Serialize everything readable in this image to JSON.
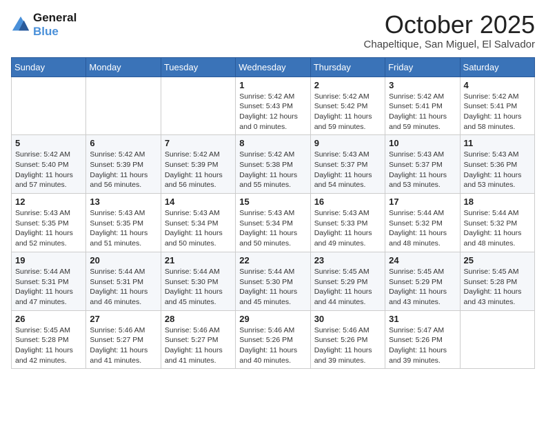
{
  "logo": {
    "line1": "General",
    "line2": "Blue"
  },
  "title": "October 2025",
  "location": "Chapeltique, San Miguel, El Salvador",
  "days_of_week": [
    "Sunday",
    "Monday",
    "Tuesday",
    "Wednesday",
    "Thursday",
    "Friday",
    "Saturday"
  ],
  "weeks": [
    [
      {
        "day": "",
        "sunrise": "",
        "sunset": "",
        "daylight": ""
      },
      {
        "day": "",
        "sunrise": "",
        "sunset": "",
        "daylight": ""
      },
      {
        "day": "",
        "sunrise": "",
        "sunset": "",
        "daylight": ""
      },
      {
        "day": "1",
        "sunrise": "Sunrise: 5:42 AM",
        "sunset": "Sunset: 5:43 PM",
        "daylight": "Daylight: 12 hours and 0 minutes."
      },
      {
        "day": "2",
        "sunrise": "Sunrise: 5:42 AM",
        "sunset": "Sunset: 5:42 PM",
        "daylight": "Daylight: 11 hours and 59 minutes."
      },
      {
        "day": "3",
        "sunrise": "Sunrise: 5:42 AM",
        "sunset": "Sunset: 5:41 PM",
        "daylight": "Daylight: 11 hours and 59 minutes."
      },
      {
        "day": "4",
        "sunrise": "Sunrise: 5:42 AM",
        "sunset": "Sunset: 5:41 PM",
        "daylight": "Daylight: 11 hours and 58 minutes."
      }
    ],
    [
      {
        "day": "5",
        "sunrise": "Sunrise: 5:42 AM",
        "sunset": "Sunset: 5:40 PM",
        "daylight": "Daylight: 11 hours and 57 minutes."
      },
      {
        "day": "6",
        "sunrise": "Sunrise: 5:42 AM",
        "sunset": "Sunset: 5:39 PM",
        "daylight": "Daylight: 11 hours and 56 minutes."
      },
      {
        "day": "7",
        "sunrise": "Sunrise: 5:42 AM",
        "sunset": "Sunset: 5:39 PM",
        "daylight": "Daylight: 11 hours and 56 minutes."
      },
      {
        "day": "8",
        "sunrise": "Sunrise: 5:42 AM",
        "sunset": "Sunset: 5:38 PM",
        "daylight": "Daylight: 11 hours and 55 minutes."
      },
      {
        "day": "9",
        "sunrise": "Sunrise: 5:43 AM",
        "sunset": "Sunset: 5:37 PM",
        "daylight": "Daylight: 11 hours and 54 minutes."
      },
      {
        "day": "10",
        "sunrise": "Sunrise: 5:43 AM",
        "sunset": "Sunset: 5:37 PM",
        "daylight": "Daylight: 11 hours and 53 minutes."
      },
      {
        "day": "11",
        "sunrise": "Sunrise: 5:43 AM",
        "sunset": "Sunset: 5:36 PM",
        "daylight": "Daylight: 11 hours and 53 minutes."
      }
    ],
    [
      {
        "day": "12",
        "sunrise": "Sunrise: 5:43 AM",
        "sunset": "Sunset: 5:35 PM",
        "daylight": "Daylight: 11 hours and 52 minutes."
      },
      {
        "day": "13",
        "sunrise": "Sunrise: 5:43 AM",
        "sunset": "Sunset: 5:35 PM",
        "daylight": "Daylight: 11 hours and 51 minutes."
      },
      {
        "day": "14",
        "sunrise": "Sunrise: 5:43 AM",
        "sunset": "Sunset: 5:34 PM",
        "daylight": "Daylight: 11 hours and 50 minutes."
      },
      {
        "day": "15",
        "sunrise": "Sunrise: 5:43 AM",
        "sunset": "Sunset: 5:34 PM",
        "daylight": "Daylight: 11 hours and 50 minutes."
      },
      {
        "day": "16",
        "sunrise": "Sunrise: 5:43 AM",
        "sunset": "Sunset: 5:33 PM",
        "daylight": "Daylight: 11 hours and 49 minutes."
      },
      {
        "day": "17",
        "sunrise": "Sunrise: 5:44 AM",
        "sunset": "Sunset: 5:32 PM",
        "daylight": "Daylight: 11 hours and 48 minutes."
      },
      {
        "day": "18",
        "sunrise": "Sunrise: 5:44 AM",
        "sunset": "Sunset: 5:32 PM",
        "daylight": "Daylight: 11 hours and 48 minutes."
      }
    ],
    [
      {
        "day": "19",
        "sunrise": "Sunrise: 5:44 AM",
        "sunset": "Sunset: 5:31 PM",
        "daylight": "Daylight: 11 hours and 47 minutes."
      },
      {
        "day": "20",
        "sunrise": "Sunrise: 5:44 AM",
        "sunset": "Sunset: 5:31 PM",
        "daylight": "Daylight: 11 hours and 46 minutes."
      },
      {
        "day": "21",
        "sunrise": "Sunrise: 5:44 AM",
        "sunset": "Sunset: 5:30 PM",
        "daylight": "Daylight: 11 hours and 45 minutes."
      },
      {
        "day": "22",
        "sunrise": "Sunrise: 5:44 AM",
        "sunset": "Sunset: 5:30 PM",
        "daylight": "Daylight: 11 hours and 45 minutes."
      },
      {
        "day": "23",
        "sunrise": "Sunrise: 5:45 AM",
        "sunset": "Sunset: 5:29 PM",
        "daylight": "Daylight: 11 hours and 44 minutes."
      },
      {
        "day": "24",
        "sunrise": "Sunrise: 5:45 AM",
        "sunset": "Sunset: 5:29 PM",
        "daylight": "Daylight: 11 hours and 43 minutes."
      },
      {
        "day": "25",
        "sunrise": "Sunrise: 5:45 AM",
        "sunset": "Sunset: 5:28 PM",
        "daylight": "Daylight: 11 hours and 43 minutes."
      }
    ],
    [
      {
        "day": "26",
        "sunrise": "Sunrise: 5:45 AM",
        "sunset": "Sunset: 5:28 PM",
        "daylight": "Daylight: 11 hours and 42 minutes."
      },
      {
        "day": "27",
        "sunrise": "Sunrise: 5:46 AM",
        "sunset": "Sunset: 5:27 PM",
        "daylight": "Daylight: 11 hours and 41 minutes."
      },
      {
        "day": "28",
        "sunrise": "Sunrise: 5:46 AM",
        "sunset": "Sunset: 5:27 PM",
        "daylight": "Daylight: 11 hours and 41 minutes."
      },
      {
        "day": "29",
        "sunrise": "Sunrise: 5:46 AM",
        "sunset": "Sunset: 5:26 PM",
        "daylight": "Daylight: 11 hours and 40 minutes."
      },
      {
        "day": "30",
        "sunrise": "Sunrise: 5:46 AM",
        "sunset": "Sunset: 5:26 PM",
        "daylight": "Daylight: 11 hours and 39 minutes."
      },
      {
        "day": "31",
        "sunrise": "Sunrise: 5:47 AM",
        "sunset": "Sunset: 5:26 PM",
        "daylight": "Daylight: 11 hours and 39 minutes."
      },
      {
        "day": "",
        "sunrise": "",
        "sunset": "",
        "daylight": ""
      }
    ]
  ]
}
